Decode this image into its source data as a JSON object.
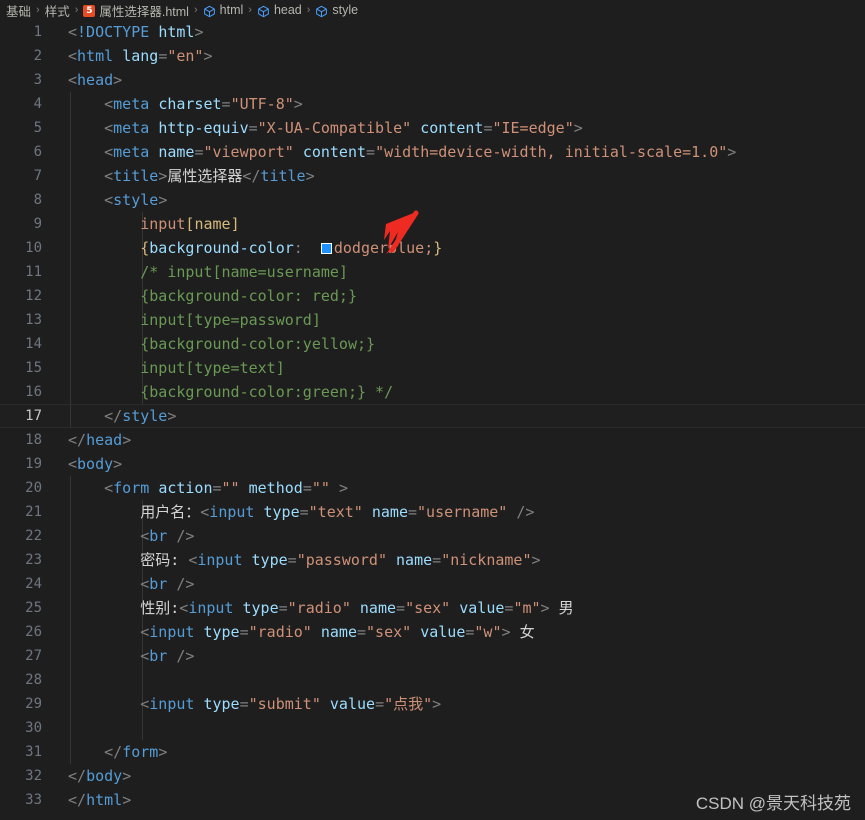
{
  "breadcrumb": {
    "items": [
      {
        "label": "基础",
        "icon": null
      },
      {
        "label": "样式",
        "icon": null
      },
      {
        "label": "属性选择器.html",
        "icon": "html5-icon"
      },
      {
        "label": "html",
        "icon": "symbol-field-icon"
      },
      {
        "label": "head",
        "icon": "symbol-field-icon"
      },
      {
        "label": "style",
        "icon": "symbol-field-icon"
      }
    ],
    "separator": "›"
  },
  "editor": {
    "language": "html",
    "active_line": 17,
    "colors": {
      "background": "#1e1e1e",
      "line_number": "#6e7681",
      "active_line_number": "#c6c6c6",
      "tag": "#569cd6",
      "attribute": "#9cdcfe",
      "string": "#ce9178",
      "comment": "#6a9955",
      "selector": "#d7ba7d",
      "text": "#d4d4d4",
      "indent_guide": "#363636"
    },
    "lines": [
      {
        "n": "1",
        "text": "<!DOCTYPE html>"
      },
      {
        "n": "2",
        "text": "<html lang=\"en\">"
      },
      {
        "n": "3",
        "text": "<head>"
      },
      {
        "n": "4",
        "text": "    <meta charset=\"UTF-8\">"
      },
      {
        "n": "5",
        "text": "    <meta http-equiv=\"X-UA-Compatible\" content=\"IE=edge\">"
      },
      {
        "n": "6",
        "text": "    <meta name=\"viewport\" content=\"width=device-width, initial-scale=1.0\">"
      },
      {
        "n": "7",
        "text": "    <title>属性选择器</title>"
      },
      {
        "n": "8",
        "text": "    <style>"
      },
      {
        "n": "9",
        "text": "        input[name]"
      },
      {
        "n": "10",
        "text": "        {background-color:  dodgerblue;}"
      },
      {
        "n": "11",
        "text": "        /* input[name=username]"
      },
      {
        "n": "12",
        "text": "        {background-color: red;}"
      },
      {
        "n": "13",
        "text": "        input[type=password]"
      },
      {
        "n": "14",
        "text": "        {background-color:yellow;}"
      },
      {
        "n": "15",
        "text": "        input[type=text]"
      },
      {
        "n": "16",
        "text": "        {background-color:green;} */"
      },
      {
        "n": "17",
        "text": "    </style>"
      },
      {
        "n": "18",
        "text": "</head>"
      },
      {
        "n": "19",
        "text": "<body>"
      },
      {
        "n": "20",
        "text": "    <form action=\"\" method=\"\" >"
      },
      {
        "n": "21",
        "text": "        用户名：<input type=\"text\" name=\"username\" />"
      },
      {
        "n": "22",
        "text": "        <br />"
      },
      {
        "n": "23",
        "text": "        密码: <input type=\"password\" name=\"nickname\">"
      },
      {
        "n": "24",
        "text": "        <br />"
      },
      {
        "n": "25",
        "text": "        性别:<input type=\"radio\" name=\"sex\" value=\"m\"> 男"
      },
      {
        "n": "26",
        "text": "        <input type=\"radio\" name=\"sex\" value=\"w\"> 女"
      },
      {
        "n": "27",
        "text": "        <br />"
      },
      {
        "n": "28",
        "text": ""
      },
      {
        "n": "29",
        "text": "        <input type=\"submit\" value=\"点我\">"
      },
      {
        "n": "30",
        "text": ""
      },
      {
        "n": "31",
        "text": "    </form>"
      },
      {
        "n": "32",
        "text": "</body>"
      },
      {
        "n": "33",
        "text": "</html>"
      }
    ],
    "color_swatch": {
      "value": "dodgerblue",
      "hex": "#1e90ff"
    }
  },
  "annotation": {
    "type": "arrow",
    "color": "#ee2b22",
    "points_to": "dodgerblue color value"
  },
  "watermark": {
    "text": "CSDN @景天科技苑"
  }
}
